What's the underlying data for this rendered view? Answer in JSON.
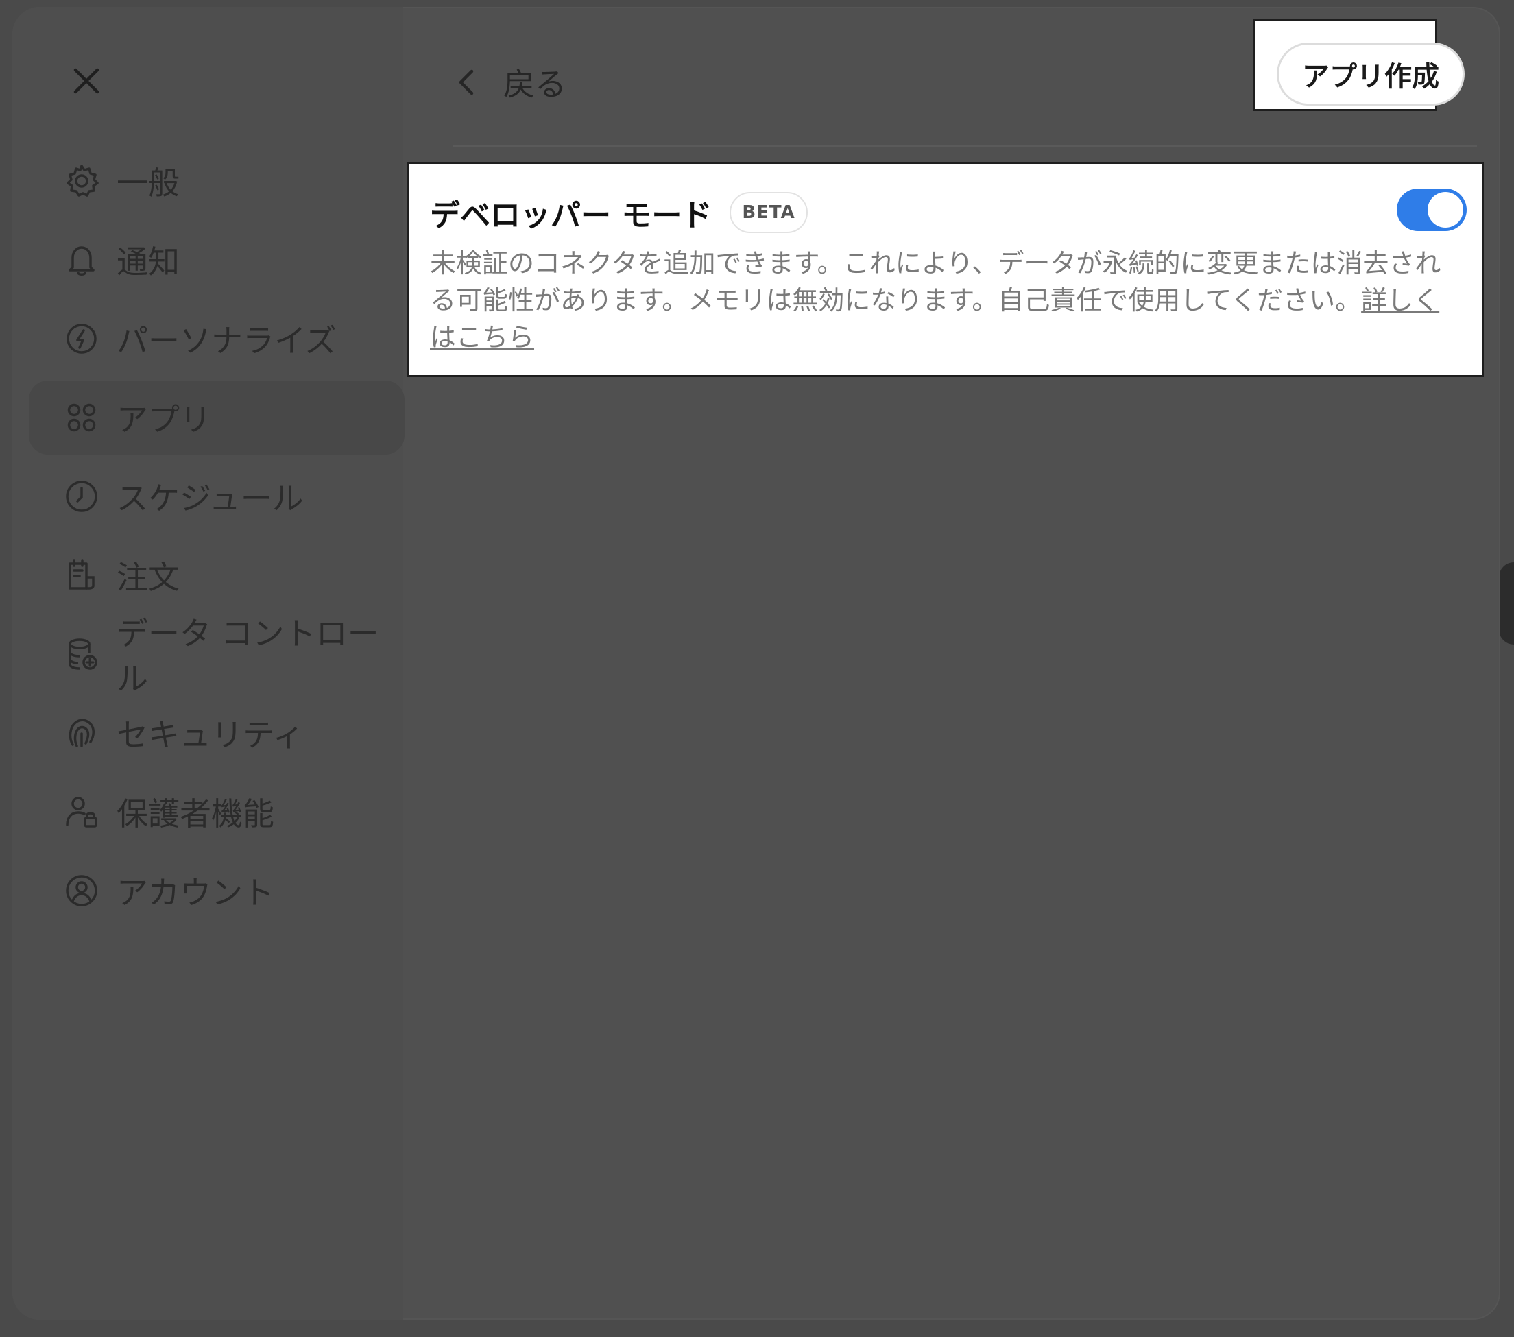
{
  "header": {
    "back_label": "戻る",
    "create_app_label": "アプリ作成"
  },
  "sidebar": {
    "items": [
      {
        "label": "一般",
        "icon": "gear-icon"
      },
      {
        "label": "通知",
        "icon": "bell-icon"
      },
      {
        "label": "パーソナライズ",
        "icon": "personalize-icon"
      },
      {
        "label": "アプリ",
        "icon": "apps-grid-icon",
        "active": true
      },
      {
        "label": "スケジュール",
        "icon": "clock-icon"
      },
      {
        "label": "注文",
        "icon": "order-icon"
      },
      {
        "label": "データ コントロール",
        "icon": "database-icon"
      },
      {
        "label": "セキュリティ",
        "icon": "security-icon"
      },
      {
        "label": "保護者機能",
        "icon": "parent-icon"
      },
      {
        "label": "アカウント",
        "icon": "account-icon"
      }
    ]
  },
  "developer_mode": {
    "title": "デベロッパー モード",
    "badge": "BETA",
    "enabled": true,
    "description": "未検証のコネクタを追加できます。これにより、データが永続的に変更または消去される可能性があります。メモリは無効になります。自己責任で使用してください。",
    "link_label": "詳しくはこちら"
  },
  "colors": {
    "toggle_on": "#2f7de8",
    "overlay": "#505050",
    "card": "#ffffff"
  }
}
